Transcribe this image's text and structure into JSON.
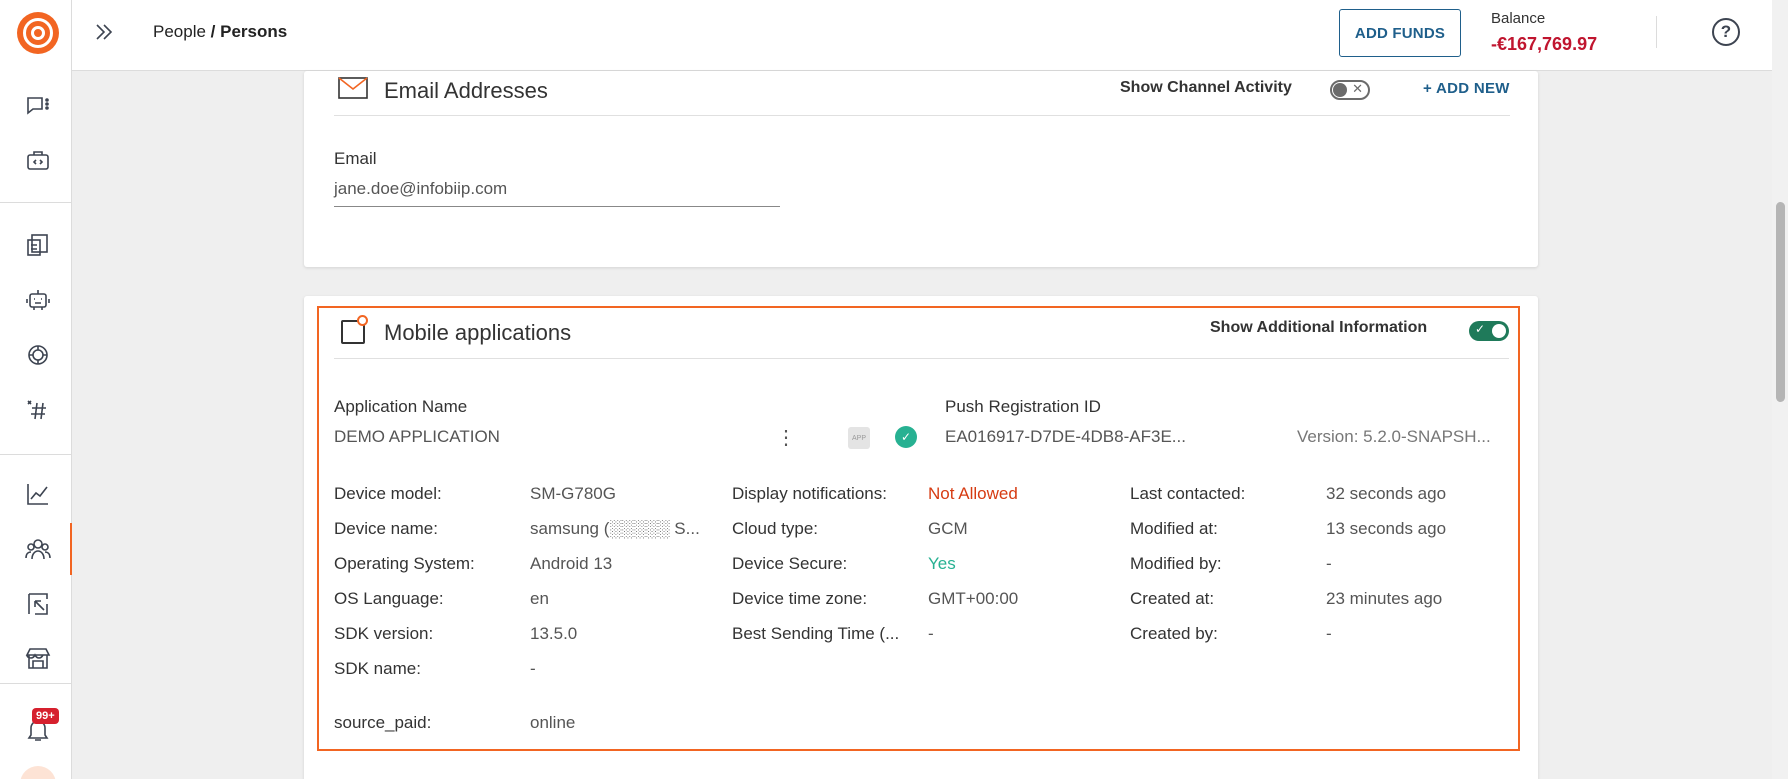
{
  "header": {
    "breadcrumb_parent": "People",
    "breadcrumb_sep": " / ",
    "breadcrumb_current": "Persons",
    "add_funds_label": "ADD FUNDS",
    "balance_label": "Balance",
    "balance_value": "-€167,769.97"
  },
  "sidebar": {
    "notification_badge": "99+"
  },
  "email_section": {
    "title": "Email Addresses",
    "toggle_label": "Show Channel Activity",
    "toggle_state": "off",
    "add_new_label": "+ ADD NEW",
    "field_label": "Email",
    "field_value": "jane.doe@infobiip.com"
  },
  "mobile_section": {
    "title": "Mobile applications",
    "toggle_label": "Show Additional Information",
    "toggle_state": "on",
    "app_name_label": "Application Name",
    "app_name_value": "DEMO APPLICATION",
    "push_id_label": "Push Registration ID",
    "push_id_value": "EA016917-D7DE-4DB8-AF3E...",
    "version": "Version: 5.2.0-SNAPSH...",
    "app_chip": "APP",
    "col1": [
      {
        "label": "Device model:",
        "value": "SM-G780G"
      },
      {
        "label": "Device name:",
        "value": "samsung (░░░░░ S..."
      },
      {
        "label": "Operating System:",
        "value": "Android 13"
      },
      {
        "label": "OS Language:",
        "value": "en"
      },
      {
        "label": "SDK version:",
        "value": "13.5.0"
      },
      {
        "label": "SDK name:",
        "value": "-"
      }
    ],
    "col2": [
      {
        "label": "Display notifications:",
        "value": "Not Allowed",
        "status": "red"
      },
      {
        "label": "Cloud type:",
        "value": "GCM"
      },
      {
        "label": "Device Secure:",
        "value": "Yes",
        "status": "green"
      },
      {
        "label": "Device time zone:",
        "value": "GMT+00:00"
      },
      {
        "label": "Best Sending Time (...",
        "value": "-"
      }
    ],
    "col3": [
      {
        "label": "Last contacted:",
        "value": "32 seconds ago"
      },
      {
        "label": "Modified at:",
        "value": "13 seconds ago"
      },
      {
        "label": "Modified by:",
        "value": "-"
      },
      {
        "label": "Created at:",
        "value": "23 minutes ago"
      },
      {
        "label": "Created by:",
        "value": "-"
      }
    ],
    "custom_label": "source_paid:",
    "custom_value": "online"
  },
  "colors": {
    "accent": "#f26522",
    "link": "#1f5f8b",
    "negative": "#c0152f",
    "success": "#27b192",
    "toggle_on": "#1f7a5a"
  }
}
